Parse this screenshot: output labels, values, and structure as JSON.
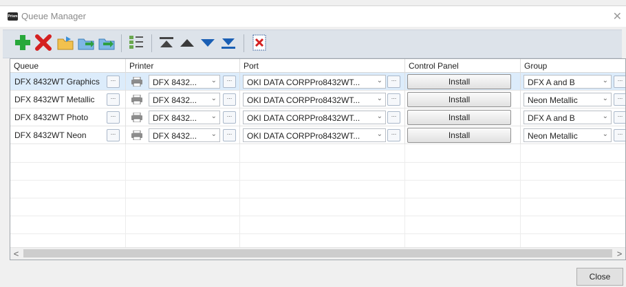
{
  "window": {
    "title": "Queue Manager",
    "app_icon_text": "Prism"
  },
  "toolbar": {
    "items": [
      {
        "name": "add-queue-button",
        "icon": "plus-icon"
      },
      {
        "name": "delete-queue-button",
        "icon": "x-icon"
      },
      {
        "name": "import-queue-button",
        "icon": "folder-arrow-icon"
      },
      {
        "name": "export-queue-button",
        "icon": "folder-export-icon"
      },
      {
        "name": "copy-queue-button",
        "icon": "folder-copy-icon"
      },
      {
        "name": "checklist-button",
        "icon": "checklist-icon"
      },
      {
        "name": "move-top-button",
        "icon": "move-top-icon"
      },
      {
        "name": "move-up-button",
        "icon": "move-up-icon"
      },
      {
        "name": "move-down-button",
        "icon": "move-down-icon"
      },
      {
        "name": "move-bottom-button",
        "icon": "move-bottom-icon"
      },
      {
        "name": "remove-printer-button",
        "icon": "printer-x-icon"
      }
    ]
  },
  "grid": {
    "columns": [
      "Queue",
      "Printer",
      "Port",
      "Control Panel",
      "Group"
    ],
    "browse_label": "...",
    "rows": [
      {
        "queue": "DFX 8432WT Graphics",
        "printer": "DFX 8432...",
        "port": "OKI DATA CORPPro8432WT...",
        "control_panel": "Install",
        "group": "DFX A and B"
      },
      {
        "queue": "DFX 8432WT Metallic",
        "printer": "DFX 8432...",
        "port": "OKI DATA CORPPro8432WT...",
        "control_panel": "Install",
        "group": "Neon Metallic"
      },
      {
        "queue": "DFX 8432WT Photo",
        "printer": "DFX 8432...",
        "port": "OKI DATA CORPPro8432WT...",
        "control_panel": "Install",
        "group": "DFX A and B"
      },
      {
        "queue": "DFX 8432WT Neon",
        "printer": "DFX 8432...",
        "port": "OKI DATA CORPPro8432WT...",
        "control_panel": "Install",
        "group": "Neon Metallic"
      }
    ],
    "selected_row": 0
  },
  "scrollbar": {
    "left_arrow": "<",
    "right_arrow": ">"
  },
  "footer": {
    "close_label": "Close"
  },
  "colors": {
    "selection": "#dcecfb",
    "toolbar_bg": "#dde3ea",
    "add_green": "#27a83a",
    "delete_red": "#d42020",
    "arrow_blue": "#1a5fb4"
  }
}
